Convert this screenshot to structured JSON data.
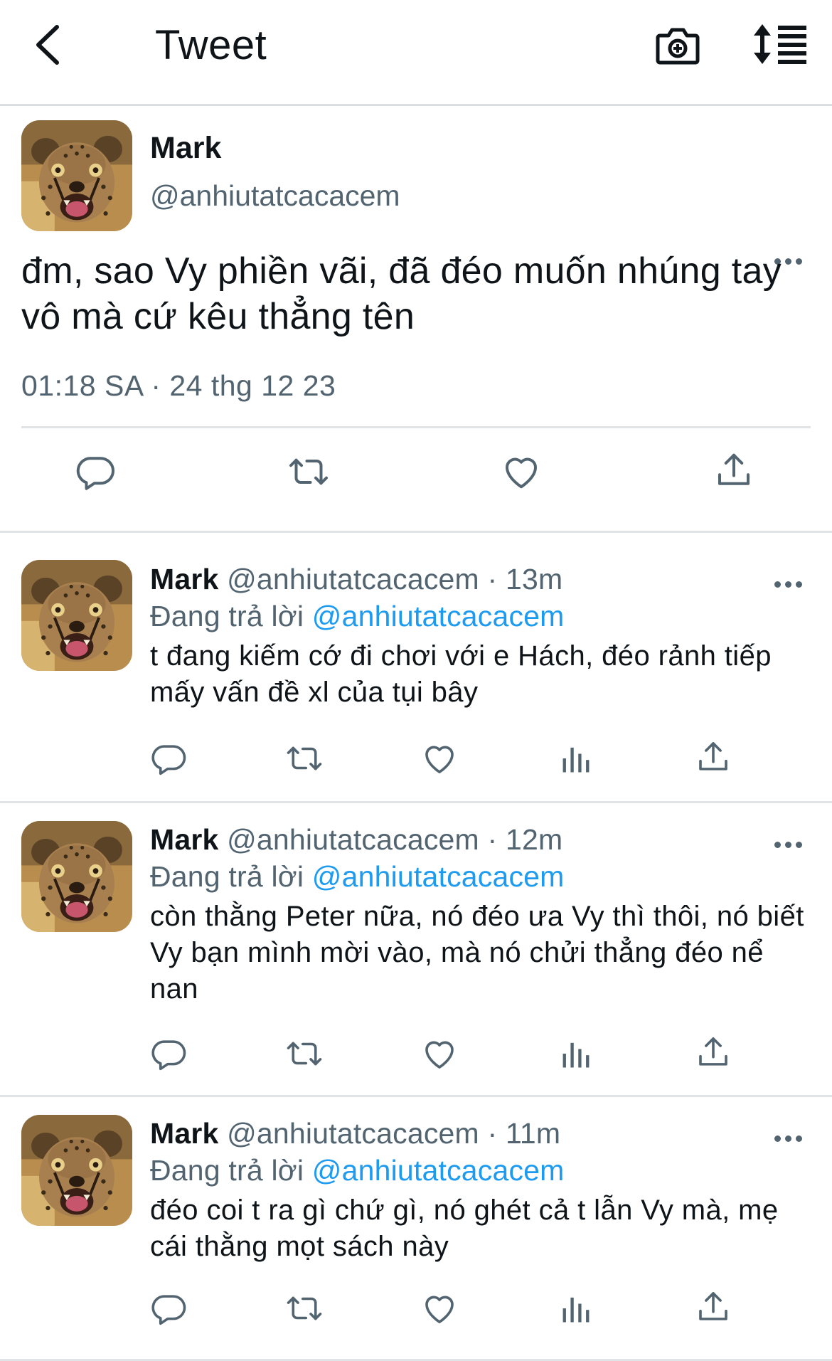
{
  "header": {
    "title": "Tweet"
  },
  "colors": {
    "accent": "#1d9bf0",
    "secondary_text": "#536471",
    "divider": "#e1e4e7"
  },
  "main_tweet": {
    "name": "Mark",
    "handle": "@anhiutatcacacem",
    "text": "đm, sao Vy phiền vãi, đã đéo muốn nhúng tay vô mà cứ kêu thẳng tên",
    "timestamp": "01:18 SA · 24 thg 12 23"
  },
  "replies": [
    {
      "name": "Mark",
      "handle": "@anhiutatcacacem",
      "separator": "·",
      "time": "13m",
      "replying_label": "Đang trả lời",
      "replying_to": "@anhiutatcacacem",
      "text": "t đang kiếm cớ đi chơi với e Hách, đéo rảnh tiếp mấy vấn đề xl của tụi bây"
    },
    {
      "name": "Mark",
      "handle": "@anhiutatcacacem",
      "separator": "·",
      "time": "12m",
      "replying_label": "Đang trả lời",
      "replying_to": "@anhiutatcacacem",
      "text": "còn thằng Peter nữa, nó đéo ưa Vy thì thôi, nó biết Vy bạn mình mời vào, mà nó chửi thẳng đéo nể nan"
    },
    {
      "name": "Mark",
      "handle": "@anhiutatcacacem",
      "separator": "·",
      "time": "11m",
      "replying_label": "Đang trả lời",
      "replying_to": "@anhiutatcacacem",
      "text": "đéo coi t ra gì chứ gì, nó ghét cả t lẫn Vy mà, mẹ cái thằng mọt sách này"
    }
  ]
}
